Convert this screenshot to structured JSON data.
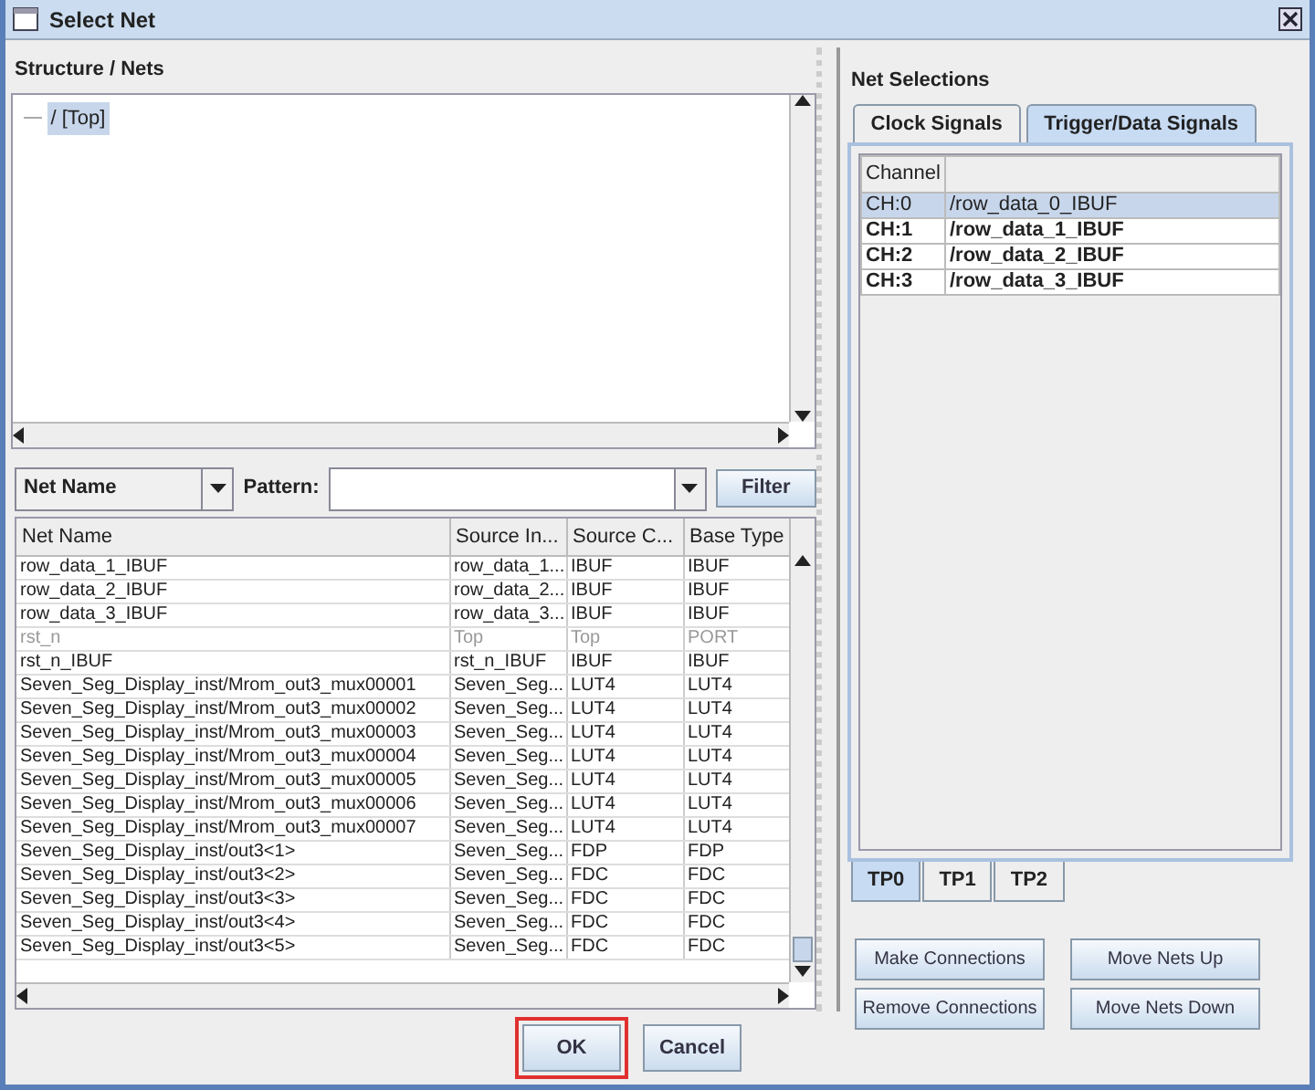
{
  "window": {
    "title": "Select Net"
  },
  "structure": {
    "heading": "Structure / Nets",
    "items": [
      {
        "label": "/ [Top]",
        "selected": true
      }
    ]
  },
  "filter": {
    "field": "Net Name",
    "pattern_label": "Pattern:",
    "button": "Filter"
  },
  "nets_table": {
    "columns": [
      "Net Name",
      "Source In...",
      "Source C...",
      "Base Type"
    ],
    "rows": [
      {
        "cells": [
          "row_data_1_IBUF",
          "row_data_1...",
          "IBUF",
          "IBUF"
        ],
        "disabled": false
      },
      {
        "cells": [
          "row_data_2_IBUF",
          "row_data_2...",
          "IBUF",
          "IBUF"
        ],
        "disabled": false
      },
      {
        "cells": [
          "row_data_3_IBUF",
          "row_data_3...",
          "IBUF",
          "IBUF"
        ],
        "disabled": false
      },
      {
        "cells": [
          "rst_n",
          "Top",
          "Top",
          "PORT"
        ],
        "disabled": true
      },
      {
        "cells": [
          "rst_n_IBUF",
          "rst_n_IBUF",
          "IBUF",
          "IBUF"
        ],
        "disabled": false
      },
      {
        "cells": [
          "Seven_Seg_Display_inst/Mrom_out3_mux00001",
          "Seven_Seg...",
          "LUT4",
          "LUT4"
        ],
        "disabled": false
      },
      {
        "cells": [
          "Seven_Seg_Display_inst/Mrom_out3_mux00002",
          "Seven_Seg...",
          "LUT4",
          "LUT4"
        ],
        "disabled": false
      },
      {
        "cells": [
          "Seven_Seg_Display_inst/Mrom_out3_mux00003",
          "Seven_Seg...",
          "LUT4",
          "LUT4"
        ],
        "disabled": false
      },
      {
        "cells": [
          "Seven_Seg_Display_inst/Mrom_out3_mux00004",
          "Seven_Seg...",
          "LUT4",
          "LUT4"
        ],
        "disabled": false
      },
      {
        "cells": [
          "Seven_Seg_Display_inst/Mrom_out3_mux00005",
          "Seven_Seg...",
          "LUT4",
          "LUT4"
        ],
        "disabled": false
      },
      {
        "cells": [
          "Seven_Seg_Display_inst/Mrom_out3_mux00006",
          "Seven_Seg...",
          "LUT4",
          "LUT4"
        ],
        "disabled": false
      },
      {
        "cells": [
          "Seven_Seg_Display_inst/Mrom_out3_mux00007",
          "Seven_Seg...",
          "LUT4",
          "LUT4"
        ],
        "disabled": false
      },
      {
        "cells": [
          "Seven_Seg_Display_inst/out3<1>",
          "Seven_Seg...",
          "FDP",
          "FDP"
        ],
        "disabled": false
      },
      {
        "cells": [
          "Seven_Seg_Display_inst/out3<2>",
          "Seven_Seg...",
          "FDC",
          "FDC"
        ],
        "disabled": false
      },
      {
        "cells": [
          "Seven_Seg_Display_inst/out3<3>",
          "Seven_Seg...",
          "FDC",
          "FDC"
        ],
        "disabled": false
      },
      {
        "cells": [
          "Seven_Seg_Display_inst/out3<4>",
          "Seven_Seg...",
          "FDC",
          "FDC"
        ],
        "disabled": false
      },
      {
        "cells": [
          "Seven_Seg_Display_inst/out3<5>",
          "Seven_Seg...",
          "FDC",
          "FDC"
        ],
        "disabled": false
      }
    ]
  },
  "net_selections": {
    "heading": "Net Selections",
    "tabs": [
      {
        "label": "Clock Signals",
        "selected": false
      },
      {
        "label": "Trigger/Data Signals",
        "selected": true
      }
    ],
    "channel_table": {
      "columns": [
        "Channel"
      ],
      "rows": [
        {
          "channel": "CH:0",
          "net": "/row_data_0_IBUF",
          "selected": true
        },
        {
          "channel": "CH:1",
          "net": "/row_data_1_IBUF",
          "selected": false
        },
        {
          "channel": "CH:2",
          "net": "/row_data_2_IBUF",
          "selected": false
        },
        {
          "channel": "CH:3",
          "net": "/row_data_3_IBUF",
          "selected": false
        }
      ]
    },
    "tp_tabs": [
      {
        "label": "TP0",
        "selected": true
      },
      {
        "label": "TP1",
        "selected": false
      },
      {
        "label": "TP2",
        "selected": false
      }
    ],
    "buttons": [
      "Make Connections",
      "Move Nets Up",
      "Remove Connections",
      "Move Nets Down"
    ]
  },
  "dialog_buttons": [
    {
      "label": "OK",
      "highlighted": true
    },
    {
      "label": "Cancel",
      "highlighted": false
    }
  ]
}
